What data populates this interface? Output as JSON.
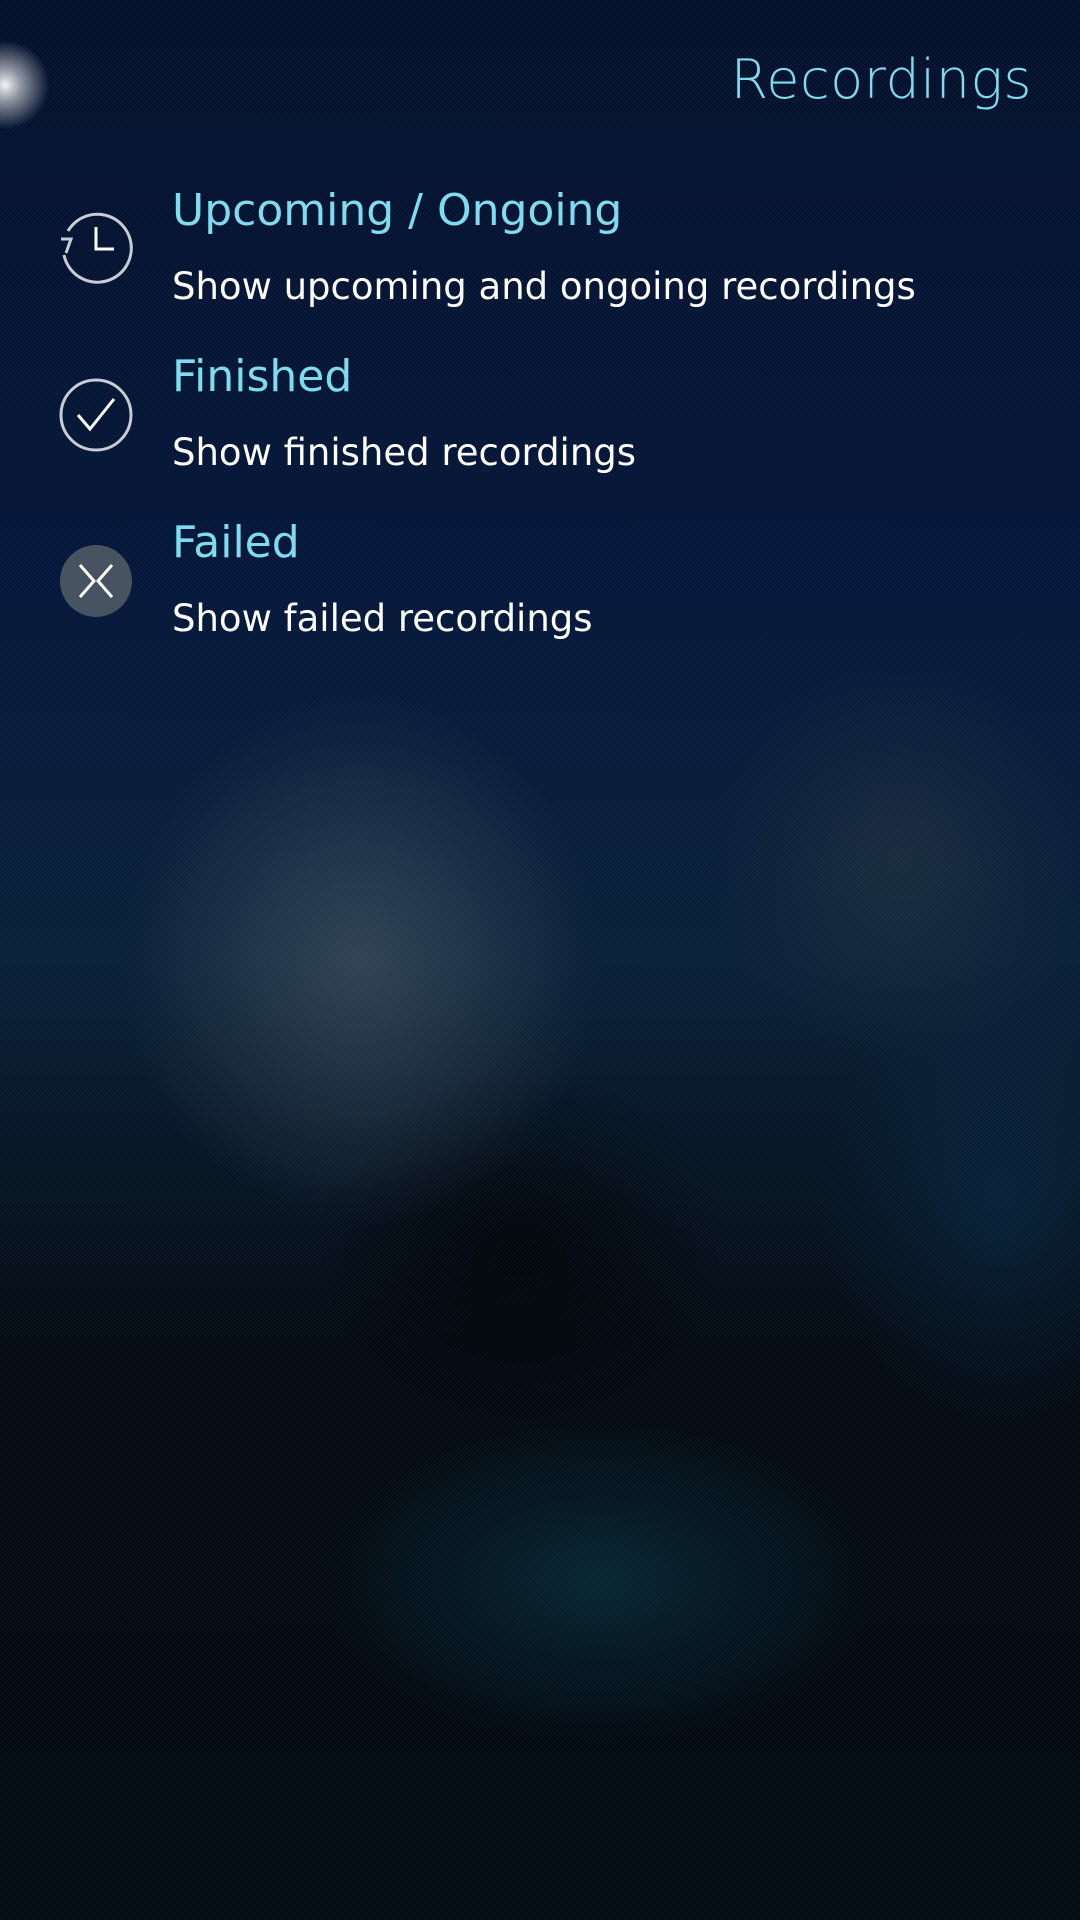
{
  "header": {
    "title": "Recordings"
  },
  "menu": {
    "items": [
      {
        "title": "Upcoming / Ongoing",
        "description": "Show upcoming and ongoing recordings",
        "icon": "clock-icon"
      },
      {
        "title": "Finished",
        "description": "Show finished recordings",
        "icon": "checkmark-icon"
      },
      {
        "title": "Failed",
        "description": "Show failed recordings",
        "icon": "failed-icon"
      }
    ]
  },
  "colors": {
    "accent": "#7fdcef",
    "text": "#ffffff",
    "background": "#04173a"
  }
}
